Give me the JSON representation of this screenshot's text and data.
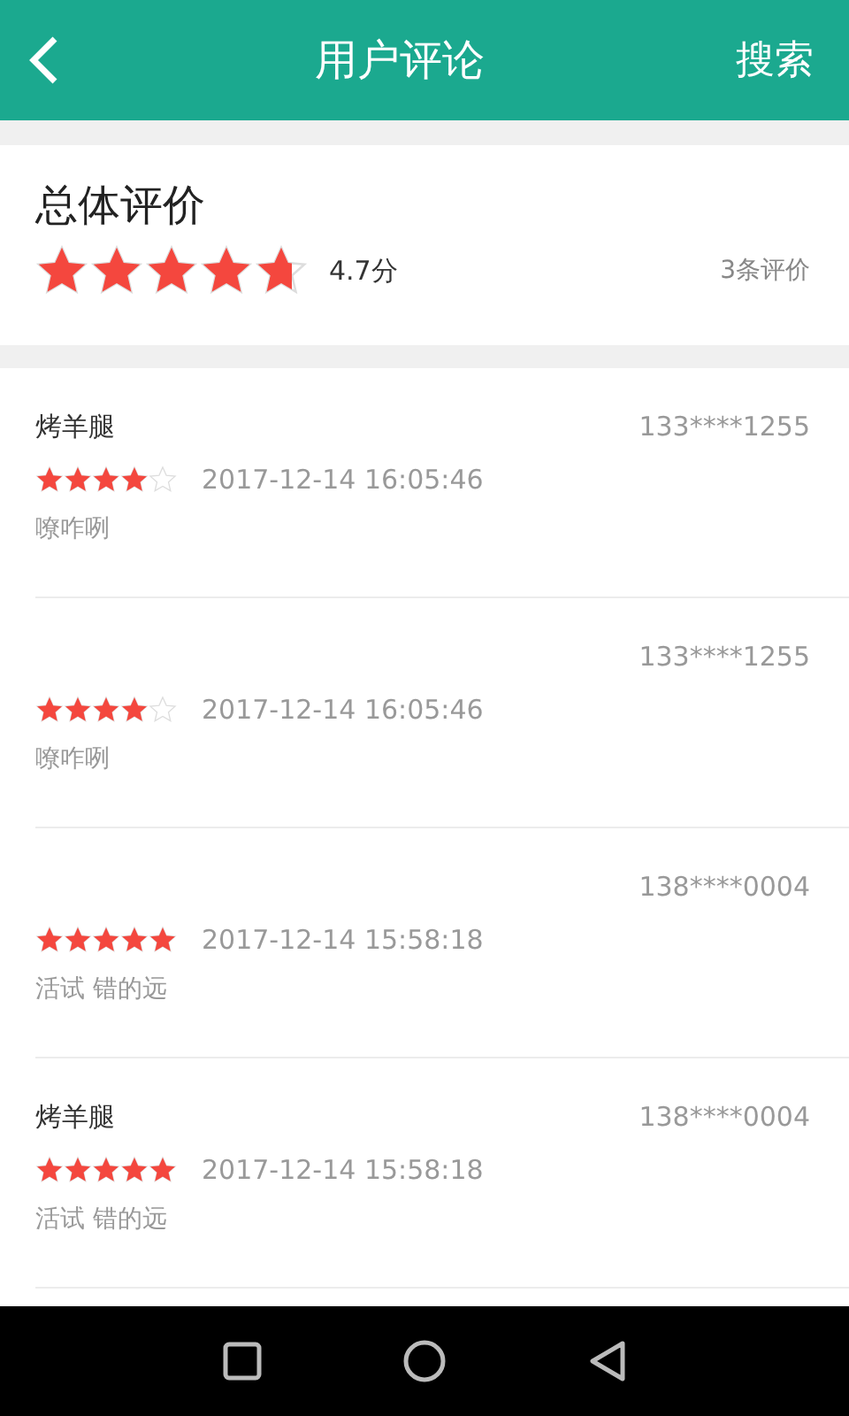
{
  "header": {
    "title": "用户评论",
    "action": "搜索"
  },
  "summary": {
    "title": "总体评价",
    "stars": 4.7,
    "score": "4.7分",
    "count": "3条评价"
  },
  "reviews": [
    {
      "name": "烤羊腿",
      "phone": "133****1255",
      "stars": 4,
      "time": "2017-12-14 16:05:46",
      "comment": "嘹咋咧"
    },
    {
      "phone": "133****1255",
      "stars": 4,
      "time": "2017-12-14 16:05:46",
      "comment": "嘹咋咧"
    },
    {
      "phone": "138****0004",
      "stars": 5,
      "time": "2017-12-14 15:58:18",
      "comment": "活试 错的远"
    },
    {
      "name": "烤羊腿",
      "phone": "138****0004",
      "stars": 5,
      "time": "2017-12-14 15:58:18",
      "comment": "活试 错的远"
    }
  ]
}
